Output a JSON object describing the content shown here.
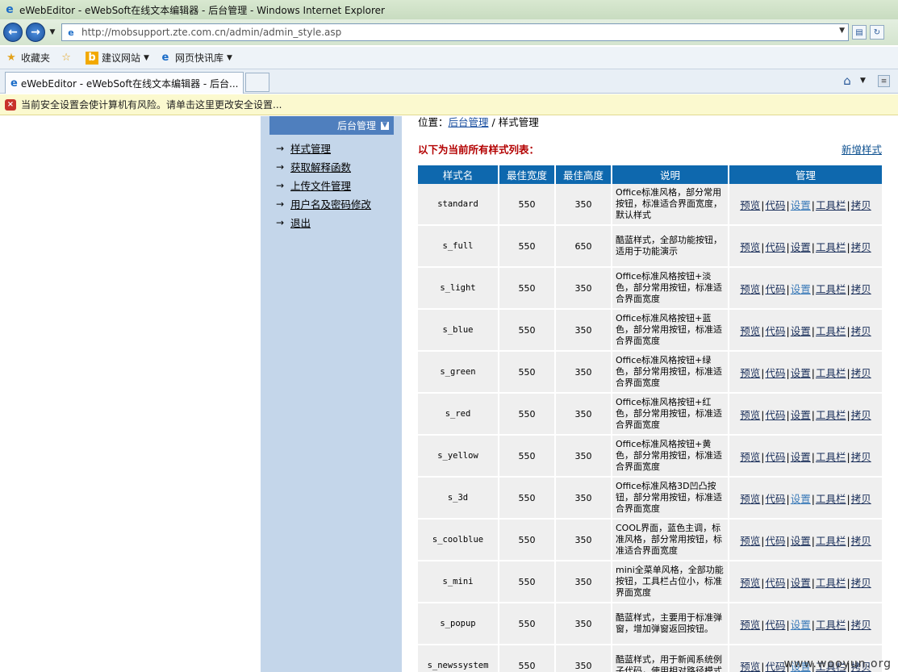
{
  "window": {
    "title": "eWebEditor - eWebSoft在线文本编辑器 - 后台管理 - Windows Internet Explorer"
  },
  "address": {
    "url": "http://mobsupport.zte.com.cn/admin/admin_style.asp"
  },
  "favorites_bar": {
    "favorites_label": "收藏夹",
    "suggested_sites_label": "建议网站",
    "web_slice_label": "网页快讯库"
  },
  "tabs": {
    "active_label": "eWebEditor - eWebSoft在线文本编辑器 - 后台..."
  },
  "infobar": {
    "message": "当前安全设置会使计算机有风险。请单击这里更改安全设置..."
  },
  "sidebar": {
    "header": "后台管理",
    "items": [
      {
        "label": "样式管理"
      },
      {
        "label": "获取解释函数"
      },
      {
        "label": "上传文件管理"
      },
      {
        "label": "用户名及密码修改"
      },
      {
        "label": "退出"
      }
    ]
  },
  "main": {
    "breadcrumb_prefix": "位置：",
    "breadcrumb_link": "后台管理",
    "breadcrumb_sep": "/",
    "breadcrumb_current": "样式管理",
    "list_title": "以下为当前所有样式列表：",
    "new_style": "新增样式",
    "table": {
      "headers": [
        "样式名",
        "最佳宽度",
        "最佳高度",
        "说明",
        "管理"
      ],
      "actions": [
        "预览",
        "代码",
        "设置",
        "工具栏",
        "拷贝"
      ],
      "rows": [
        {
          "name": "standard",
          "width": "550",
          "height": "350",
          "desc": "Office标准风格，部分常用按钮，标准适合界面宽度，默认样式"
        },
        {
          "name": "s_full",
          "width": "550",
          "height": "650",
          "desc": "酷蓝样式，全部功能按钮，适用于功能演示"
        },
        {
          "name": "s_light",
          "width": "550",
          "height": "350",
          "desc": "Office标准风格按钮+淡色，部分常用按钮，标准适合界面宽度"
        },
        {
          "name": "s_blue",
          "width": "550",
          "height": "350",
          "desc": "Office标准风格按钮+蓝色，部分常用按钮，标准适合界面宽度"
        },
        {
          "name": "s_green",
          "width": "550",
          "height": "350",
          "desc": "Office标准风格按钮+绿色，部分常用按钮，标准适合界面宽度"
        },
        {
          "name": "s_red",
          "width": "550",
          "height": "350",
          "desc": "Office标准风格按钮+红色，部分常用按钮，标准适合界面宽度"
        },
        {
          "name": "s_yellow",
          "width": "550",
          "height": "350",
          "desc": "Office标准风格按钮+黄色，部分常用按钮，标准适合界面宽度"
        },
        {
          "name": "s_3d",
          "width": "550",
          "height": "350",
          "desc": "Office标准风格3D凹凸按钮，部分常用按钮，标准适合界面宽度"
        },
        {
          "name": "s_coolblue",
          "width": "550",
          "height": "350",
          "desc": "COOL界面，蓝色主调，标准风格，部分常用按钮，标准适合界面宽度"
        },
        {
          "name": "s_mini",
          "width": "550",
          "height": "350",
          "desc": "mini全菜单风格，全部功能按钮，工具栏占位小，标准界面宽度"
        },
        {
          "name": "s_popup",
          "width": "550",
          "height": "350",
          "desc": "酷蓝样式，主要用于标准弹窗，增加弹窗返回按钮。"
        },
        {
          "name": "s_newssystem",
          "width": "550",
          "height": "350",
          "desc": "酷蓝样式，用于新闻系统例子代码，使用相对路径模式"
        }
      ]
    }
  },
  "watermark": "www.wooyun.org",
  "colors": {
    "sidebar_bg": "#c4d6ea",
    "sidebar_header_bg": "#4f7fbe",
    "table_header_bg": "#0e68ae",
    "list_title_red": "#b30000",
    "infobar_bg": "#fbf9cf"
  }
}
